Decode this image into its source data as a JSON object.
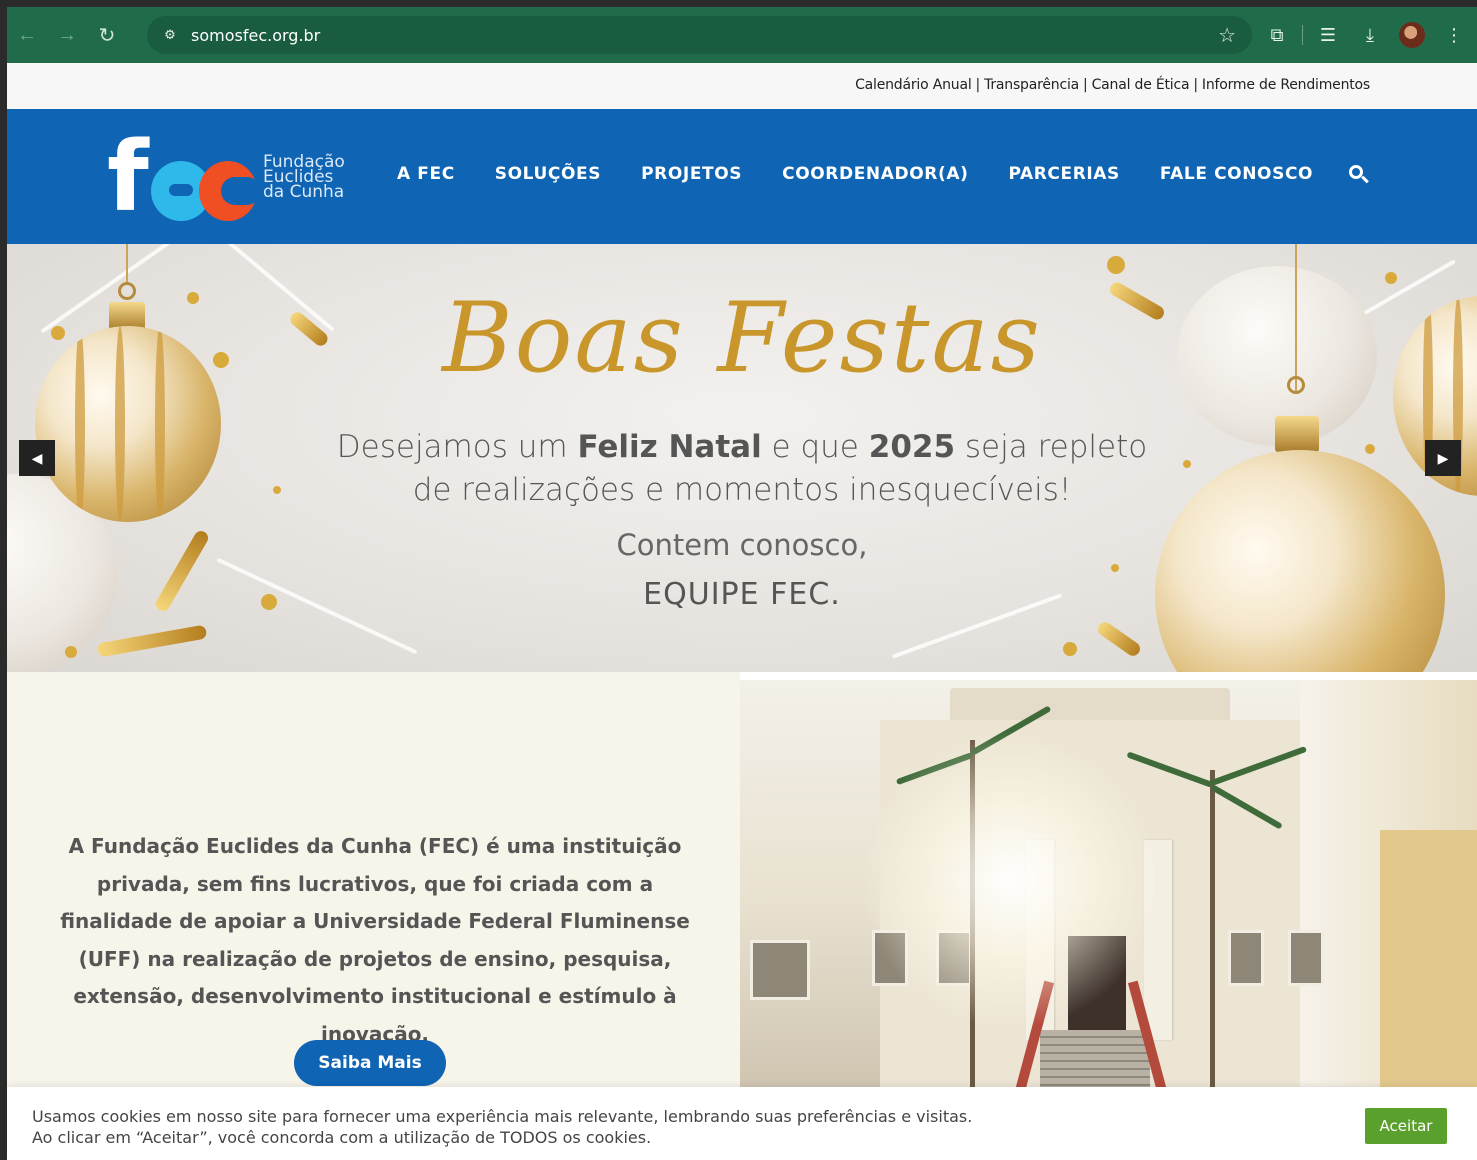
{
  "browser": {
    "url": "somosfec.org.br",
    "back_icon": "arrow-left",
    "forward_icon": "arrow-right",
    "reload_icon": "reload",
    "toolbar_color": "#1f6b4a"
  },
  "utility_links": [
    "Calendário Anual",
    "Transparência",
    "Canal de Ética",
    "Informe de Rendimentos"
  ],
  "utility_separator": "|",
  "header": {
    "logo_letters": "fec",
    "logo_text_1": "Fundação",
    "logo_text_2": "Euclides",
    "logo_text_3": "da Cunha",
    "nav": [
      "A FEC",
      "SOLUÇÕES",
      "PROJETOS",
      "COORDENADOR(A)",
      "PARCERIAS",
      "FALE CONOSCO"
    ],
    "bg_color": "#0f64b4"
  },
  "banner": {
    "title": "Boas Festas",
    "line1_a": "Desejamos um ",
    "line1_b": "Feliz Natal",
    "line1_c": " e que ",
    "line1_d": "2025",
    "line1_e": " seja repleto",
    "line2": "de realizações e momentos inesquecíveis!",
    "sign1": "Contem conosco,",
    "sign2": "EQUIPE FEC.",
    "prev_icon": "◀",
    "next_icon": "▶"
  },
  "about": {
    "text": "A Fundação Euclides da Cunha (FEC) é uma instituição privada, sem fins lucrativos, que foi criada com a finalidade de apoiar a Universidade Federal Fluminense (UFF) na realização de projetos de ensino, pesquisa, extensão, desenvolvimento institucional e estímulo à inovação.",
    "button": "Saiba Mais"
  },
  "cookie": {
    "line1": "Usamos cookies em nosso site para fornecer uma experiência mais relevante, lembrando suas preferências e visitas.",
    "line2": "Ao clicar em “Aceitar”, você concorda com a utilização de TODOS os cookies.",
    "accept": "Aceitar"
  }
}
